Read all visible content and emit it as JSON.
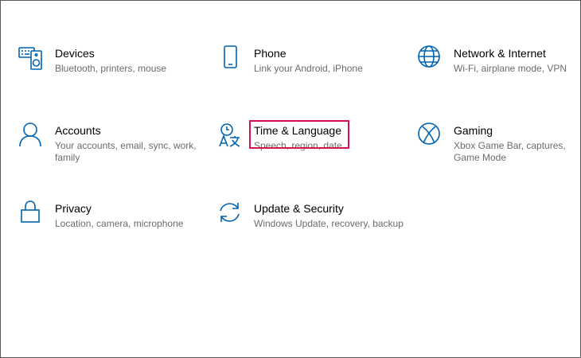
{
  "accent_color": "#0063b1",
  "highlight_color": "#d6114a",
  "tiles": [
    {
      "icon": "keyboard-speaker-icon",
      "title": "Devices",
      "desc": "Bluetooth, printers, mouse"
    },
    {
      "icon": "phone-icon",
      "title": "Phone",
      "desc": "Link your Android, iPhone"
    },
    {
      "icon": "globe-icon",
      "title": "Network & Internet",
      "desc": "Wi-Fi, airplane mode, VPN"
    },
    {
      "icon": "person-icon",
      "title": "Accounts",
      "desc": "Your accounts, email, sync, work, family"
    },
    {
      "icon": "time-language-icon",
      "title": "Time & Language",
      "desc": "Speech, region, date"
    },
    {
      "icon": "xbox-icon",
      "title": "Gaming",
      "desc": "Xbox Game Bar, captures, Game Mode"
    },
    {
      "icon": "lock-icon",
      "title": "Privacy",
      "desc": "Location, camera, microphone"
    },
    {
      "icon": "sync-arrows-icon",
      "title": "Update & Security",
      "desc": "Windows Update, recovery, backup"
    }
  ]
}
